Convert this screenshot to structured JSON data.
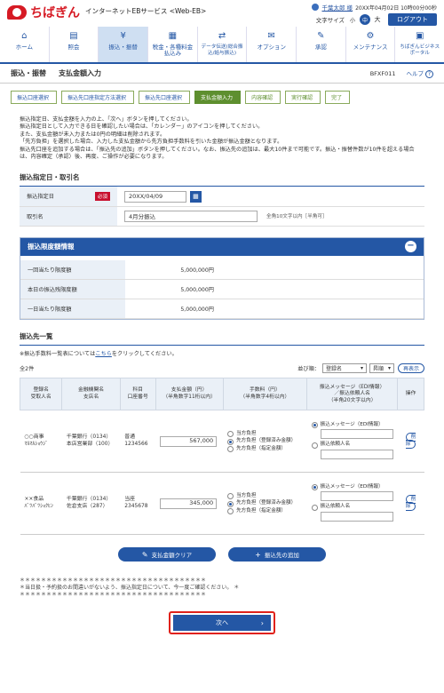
{
  "header": {
    "logo_text": "ちばぎん",
    "service": "インターネットEBサービス <Web-EB>",
    "user_name": "千葉太郎 様",
    "login_time": "20XX年04月02日 10時00分00秒",
    "text_size_label": "文字サイズ",
    "size_small": "小",
    "size_mid": "中",
    "size_large": "大",
    "logout": "ログアウト"
  },
  "nav": [
    {
      "label": "ホーム",
      "icon": "⌂"
    },
    {
      "label": "照会",
      "icon": "▤"
    },
    {
      "label": "振込・振替",
      "icon": "¥"
    },
    {
      "label": "税金・各種料金払込み",
      "icon": "▦"
    },
    {
      "label": "データ伝送(総合振込/給与振込)",
      "icon": "⇄"
    },
    {
      "label": "オプション",
      "icon": "✉"
    },
    {
      "label": "承認",
      "icon": "✎"
    },
    {
      "label": "メンテナンス",
      "icon": "⚙"
    },
    {
      "label": "ちばぎんビジネスポータル",
      "icon": "▣"
    }
  ],
  "page": {
    "title": "振込・振替",
    "subtitle": "支払金額入力",
    "screen_id": "BFXF011",
    "help": "ヘルプ",
    "help_icon": "?"
  },
  "steps": [
    "振込口座選択",
    "振込先口座指定方法選択",
    "振込先口座選択",
    "支払金額入力",
    "内容確認",
    "実行確認",
    "完了"
  ],
  "intro": [
    "振込指定日、支払金額を入力の上、「次へ」ボタンを押してください。",
    "振込指定日として入力できる日を確認したい場合は、「カレンダー」のアイコンを押してください。",
    "また、支払金額が未入力または0円の明細は削除されます。",
    "「先方負担」を選択した場合、入力した支払金額から先方負担手数料を引いた金額が振込金額となります。",
    "振込先口座を追加する場合は、「振込先の追加」ボタンを押してください。なお、振込先の追加は、最大10件まで可能です。振込・振替件数が10件を超える場合は、内容確定（承認）後、再度、ご操作が必要になります。"
  ],
  "transfer_section": {
    "title": "振込指定日・取引名",
    "date_label": "振込指定日",
    "required": "必須",
    "date_value": "20XX/04/09",
    "calendar_icon": "▦",
    "name_label": "取引名",
    "name_value": "4月分振込",
    "name_note": "全角10文字以内［半角可］"
  },
  "limit_panel": {
    "title": "振込限度額情報",
    "toggle": "−",
    "rows": [
      {
        "label": "一回当たり限度額",
        "value": "5,000,000円"
      },
      {
        "label": "本日の振込残限度額",
        "value": "5,000,000円"
      },
      {
        "label": "一日当たり限度額",
        "value": "5,000,000円"
      }
    ]
  },
  "payees": {
    "title": "振込先一覧",
    "note_prefix": "※振込手数料一覧表については",
    "note_link": "こちら",
    "note_suffix": "をクリックしてください。",
    "count": "全2件",
    "sort_label": "並び順：",
    "sort_value": "登録名",
    "order_value": "昇順",
    "reshow": "再表示",
    "headers": [
      "登録名\n受取人名",
      "金融機関名\n支店名",
      "科目\n口座番号",
      "支払金額（円）\n（半角数字11桁以内）",
      "手数料（円）\n（半角数字4桁以内）",
      "振込メッセージ（EDI情報）\n／振込依頼人名\n（半角20文字以内）",
      "操作"
    ],
    "rows": [
      {
        "reg_name": "○○商事",
        "recipient": "ﾏﾙﾏﾙｼｮｳｼﾞ",
        "bank": "千葉銀行（0134）",
        "branch": "本店営業部（100）",
        "account_type": "普通",
        "account_no": "1234566",
        "amount": "567,000",
        "fee_opt1": "当方負担",
        "fee_opt2": "先方負担（登録済み金額）",
        "fee_opt3": "先方負担（指定金額）",
        "fee_selected": 2,
        "msg_opt1": "振込メッセージ（EDI情報）",
        "msg_opt2": "振込依頼人名",
        "delete": "削除"
      },
      {
        "reg_name": "××食品",
        "recipient": "ﾊﾞﾂﾊﾞﾂｼｮｸﾋﾝ",
        "bank": "千葉銀行（0134）",
        "branch": "佐倉支店（287）",
        "account_type": "当座",
        "account_no": "2345678",
        "amount": "345,000",
        "fee_opt1": "当方負担",
        "fee_opt2": "先方負担（登録済み金額）",
        "fee_opt3": "先方負担（指定金額）",
        "fee_selected": 2,
        "msg_opt1": "振込メッセージ（EDI情報）",
        "msg_opt2": "振込依頼人名",
        "delete": "削除"
      }
    ]
  },
  "buttons": {
    "clear": "支払金額クリア",
    "clear_icon": "✎",
    "add": "振込先の追加",
    "add_icon": "+",
    "next": "次へ",
    "next_icon": "›"
  },
  "notice": {
    "stars": "＊＊＊＊＊＊＊＊＊＊＊＊＊＊＊＊＊＊＊＊＊＊＊＊＊＊＊＊＊＊＊＊＊＊＊",
    "text": "＊当日扱・予約扱のお間違いがないよう、振込指定日について、今一度ご確認ください。 ＊"
  },
  "colors": {
    "brand_red": "#d61a24",
    "brand_blue": "#2457a5",
    "step_green": "#5e8f2f"
  }
}
